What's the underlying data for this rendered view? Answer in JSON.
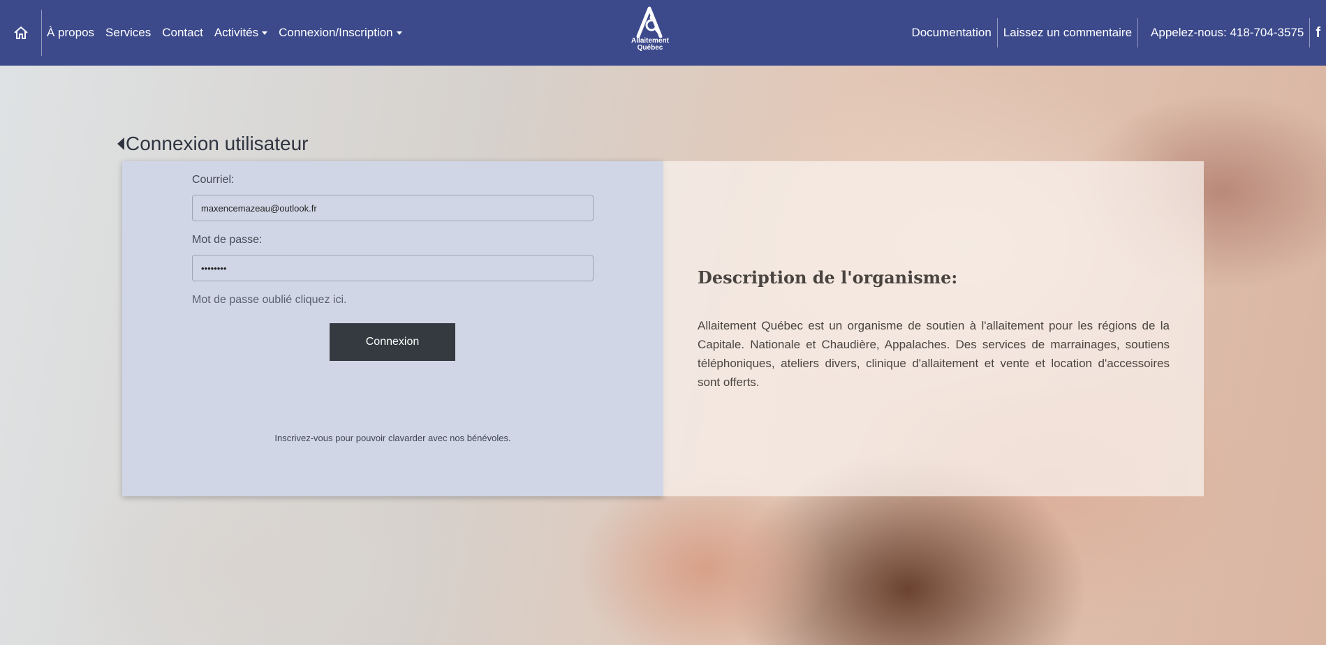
{
  "navbar": {
    "home_icon": "home-icon",
    "links": {
      "about": "À propos",
      "services": "Services",
      "contact": "Contact",
      "activities": "Activités",
      "login_register": "Connexion/Inscription"
    },
    "logo": {
      "line1": "Allaitement",
      "line2": "Québec"
    },
    "right": {
      "documentation": "Documentation",
      "comment": "Laissez un commentaire",
      "phone": "Appelez-nous: 418-704-3575",
      "facebook_label": "f",
      "facebook_icon": "facebook-icon"
    },
    "colors": {
      "background": "#3c4a8c"
    }
  },
  "login": {
    "title": "Connexion utilisateur",
    "email_label": "Courriel:",
    "email_value": "maxencemazeau@outlook.fr",
    "password_label": "Mot de passe:",
    "password_value": "••••••••",
    "forgot": "Mot de passe oublié cliquez ici.",
    "submit": "Connexion",
    "register_note": "Inscrivez-vous pour pouvoir clavarder avec nos bénévoles."
  },
  "description": {
    "title": "Description de l'organisme:",
    "text": "Allaitement Québec est un organisme de soutien à l'allaitement pour les régions de la Capitale. Nationale et Chaudière, Appalaches. Des services de marrainages, soutiens téléphoniques, ateliers divers, clinique d'allaitement et vente et location d'accessoires sont offerts."
  }
}
